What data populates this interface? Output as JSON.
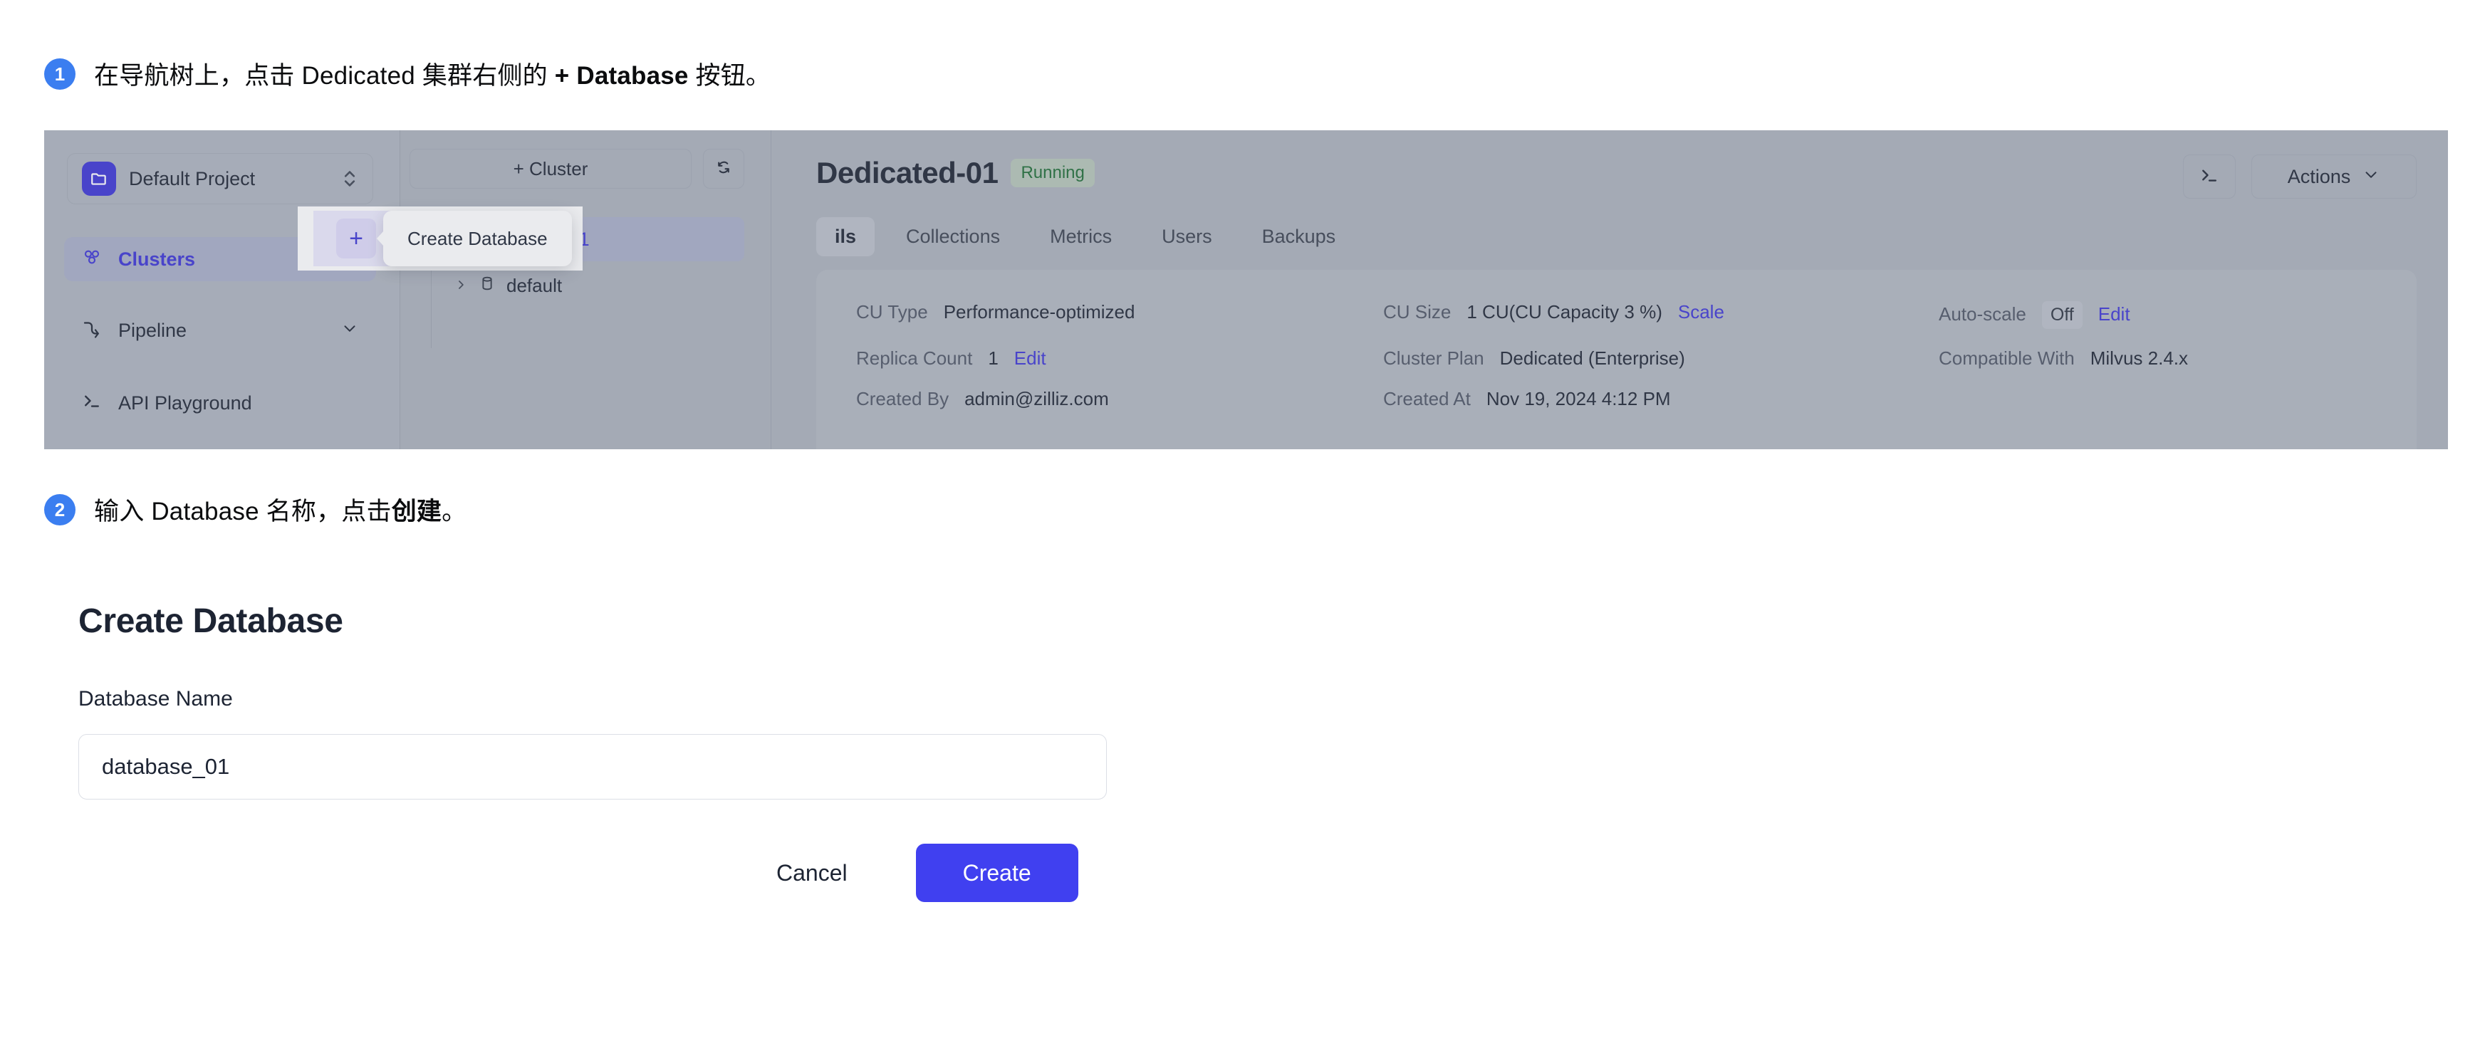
{
  "steps": [
    {
      "number": "1",
      "text_before": "在导航树上，点击 Dedicated 集群右侧的 ",
      "text_bold": "+ Database",
      "text_after": " 按钮。"
    },
    {
      "number": "2",
      "text_before": "输入 Database 名称，点击",
      "text_bold": "创建",
      "text_after": "。"
    }
  ],
  "app": {
    "sidebar": {
      "project": {
        "name": "Default Project",
        "icon": "folder-icon",
        "switch_icon": "up-down-chevron-icon"
      },
      "items": [
        {
          "label": "Clusters",
          "icon": "clusters-icon",
          "active": true
        },
        {
          "label": "Pipeline",
          "icon": "pipeline-icon",
          "active": false,
          "chevron": "chevron-down-icon"
        },
        {
          "label": "API Playground",
          "icon": "terminal-icon",
          "active": false
        }
      ]
    },
    "tree": {
      "add_cluster_label": "+ Cluster",
      "refresh_icon": "refresh-icon",
      "cluster": {
        "label": "Dedicated-01",
        "icon": "clusters-icon",
        "expand_icon": "chevron-down-icon"
      },
      "database": {
        "label": "default",
        "icon": "database-icon",
        "expand_icon": "chevron-right-icon"
      },
      "plus_button_label": "+",
      "tooltip_label": "Create Database"
    },
    "header": {
      "title": "Dedicated-01",
      "status": "Running",
      "terminal_icon": "terminal-icon",
      "actions_label": "Actions",
      "actions_chevron": "chevron-down-icon"
    },
    "tabs": [
      {
        "label": "ils",
        "active": true
      },
      {
        "label": "Collections",
        "active": false
      },
      {
        "label": "Metrics",
        "active": false
      },
      {
        "label": "Users",
        "active": false
      },
      {
        "label": "Backups",
        "active": false
      }
    ],
    "details": [
      {
        "key": "CU Type",
        "value": "Performance-optimized"
      },
      {
        "key": "CU Size",
        "value": "1 CU(CU Capacity 3 %)",
        "link": "Scale"
      },
      {
        "key": "Auto-scale",
        "pill": "Off",
        "link": "Edit"
      },
      {
        "key": "Replica Count",
        "value": "1",
        "link": "Edit"
      },
      {
        "key": "Cluster Plan",
        "value": "Dedicated (Enterprise)"
      },
      {
        "key": "Compatible With",
        "value": "Milvus 2.4.x"
      },
      {
        "key": "Created By",
        "value": "admin@zilliz.com"
      },
      {
        "key": "Created At",
        "value": "Nov 19, 2024 4:12 PM"
      }
    ]
  },
  "form": {
    "heading": "Create Database",
    "name_label": "Database Name",
    "name_value": "database_01",
    "name_placeholder": "database_01",
    "cancel_label": "Cancel",
    "create_label": "Create"
  },
  "colors": {
    "accent": "#4040f0",
    "brand": "#3b34d4",
    "step_badge": "#3b7ef0",
    "status_running": "#1d6b34",
    "capture_bg": "#aab0ba"
  }
}
